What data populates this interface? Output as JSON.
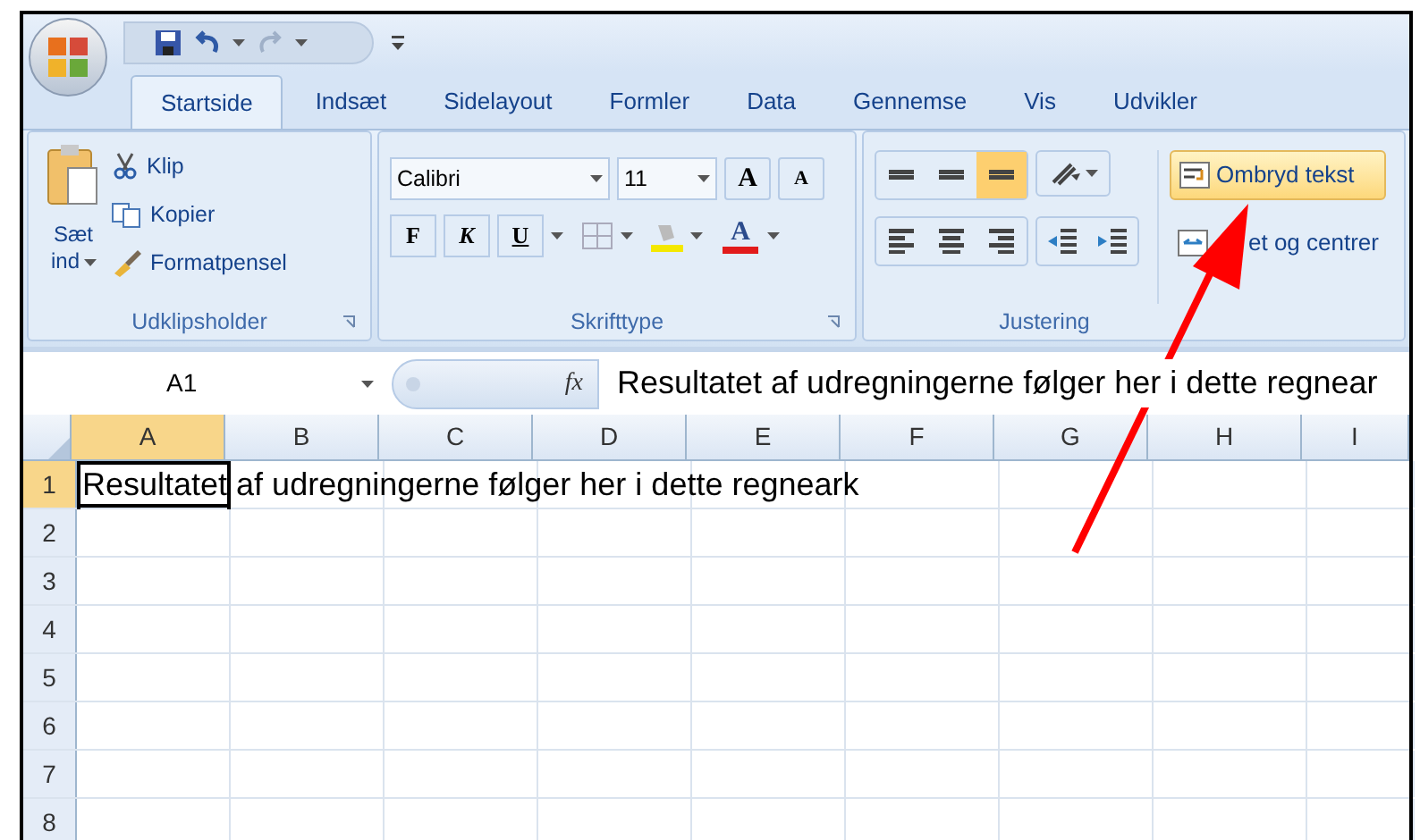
{
  "tabs": [
    {
      "label": "Startside",
      "selected": true
    },
    {
      "label": "Indsæt",
      "selected": false
    },
    {
      "label": "Sidelayout",
      "selected": false
    },
    {
      "label": "Formler",
      "selected": false
    },
    {
      "label": "Data",
      "selected": false
    },
    {
      "label": "Gennemse",
      "selected": false
    },
    {
      "label": "Vis",
      "selected": false
    },
    {
      "label": "Udvikler",
      "selected": false
    }
  ],
  "clipboard": {
    "label": "Udklipsholder",
    "paste_line1": "Sæt",
    "paste_line2": "ind",
    "items": [
      {
        "kind": "cut",
        "label": "Klip"
      },
      {
        "kind": "copy",
        "label": "Kopier"
      },
      {
        "kind": "brush",
        "label": "Formatpensel"
      }
    ]
  },
  "font": {
    "label": "Skrifttype",
    "name": "Calibri",
    "size": "11",
    "styles": [
      "F",
      "K",
      "U"
    ],
    "grow": "A",
    "shrink": "A",
    "color_letter": "A"
  },
  "alignment": {
    "label": "Justering",
    "vertical": [
      {
        "selected": false
      },
      {
        "selected": false
      },
      {
        "selected": true
      }
    ],
    "wrap_text": {
      "label": "Ombryd tekst",
      "highlighted": true
    },
    "merge": {
      "label": "et og centrer"
    }
  },
  "formula_bar": {
    "name_box": "A1",
    "fx": "fx",
    "formula": "Resultatet af udregningerne følger her i dette regnear"
  },
  "grid": {
    "columns": [
      {
        "label": "A",
        "selected": true
      },
      {
        "label": "B",
        "selected": false
      },
      {
        "label": "C",
        "selected": false
      },
      {
        "label": "D",
        "selected": false
      },
      {
        "label": "E",
        "selected": false
      },
      {
        "label": "F",
        "selected": false
      },
      {
        "label": "G",
        "selected": false
      },
      {
        "label": "H",
        "selected": false
      },
      {
        "label": "I",
        "selected": false
      }
    ],
    "rows": [
      {
        "label": "1",
        "selected": true,
        "text": "Resultatet af udregningerne følger her i dette regneark"
      },
      {
        "label": "2",
        "selected": false
      },
      {
        "label": "3",
        "selected": false
      },
      {
        "label": "4",
        "selected": false
      },
      {
        "label": "5",
        "selected": false
      },
      {
        "label": "6",
        "selected": false
      },
      {
        "label": "7",
        "selected": false
      },
      {
        "label": "8",
        "selected": false
      }
    ]
  }
}
